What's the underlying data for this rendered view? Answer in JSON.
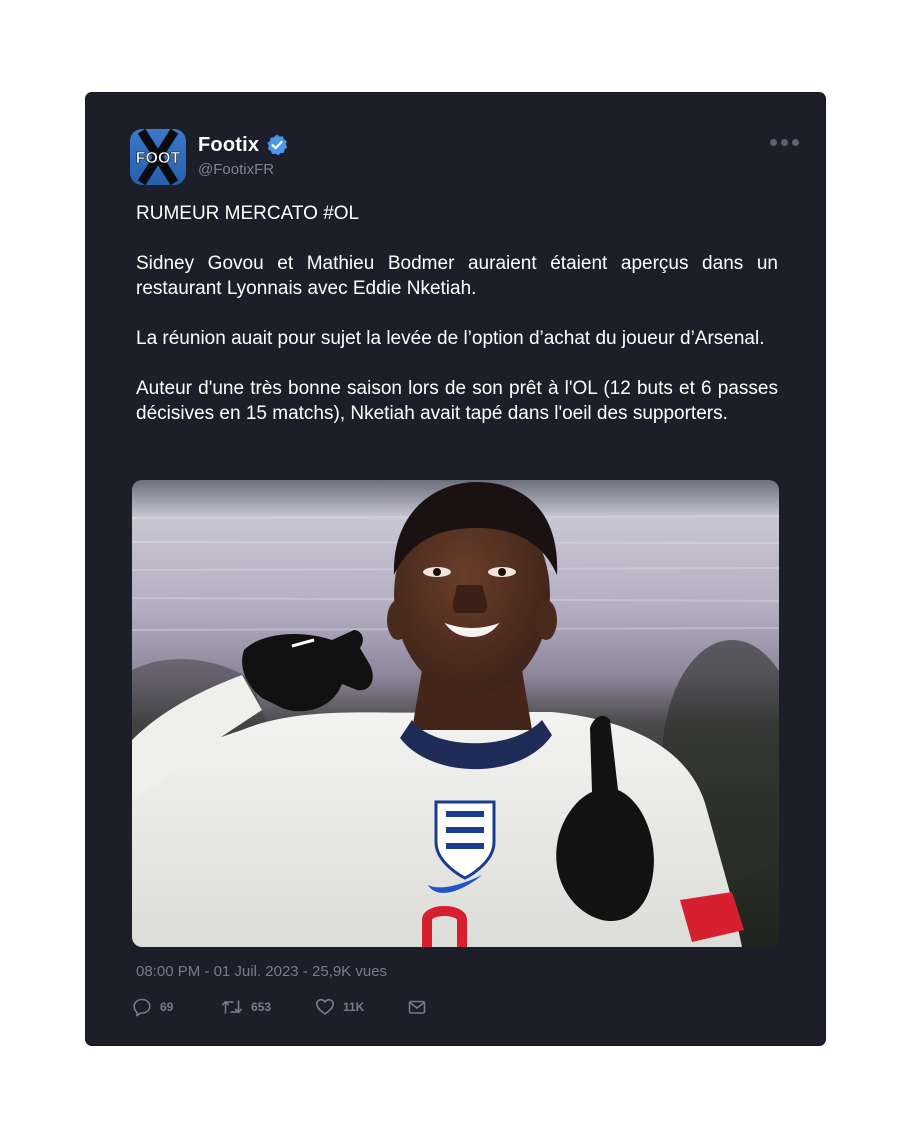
{
  "tweet": {
    "author": {
      "display_name": "Footix",
      "handle": "@FootixFR",
      "avatar_text": "FOOT",
      "verified": true,
      "verified_icon": "verified-badge-icon"
    },
    "more_icon": "more-options-icon",
    "paragraphs": [
      "RUMEUR MERCATO #OL",
      "Sidney Govou et Mathieu Bodmer auraient étaient aperçus dans un restaurant Lyonnais avec Eddie Nketiah.",
      "La réunion auait pour sujet la levée de l’option d’achat du joueur d’Arsenal.",
      "Auteur d'une très bonne saison lors de son prêt à l'OL (12 buts et 6 passes décisives en 15 matchs), Nketiah avait tapé dans l'oeil des supporters."
    ],
    "meta": {
      "time": "08:00 PM",
      "separator": " - ",
      "date": "01 Juil. 2023",
      "views": "25,9K vues"
    },
    "actions": {
      "replies": {
        "icon": "reply-icon",
        "count": "69"
      },
      "retweets": {
        "icon": "retweet-icon",
        "count": "653"
      },
      "likes": {
        "icon": "heart-icon",
        "count": "11K"
      },
      "share": {
        "icon": "mail-icon"
      }
    }
  },
  "colors": {
    "card_background": "#1c1e29",
    "text_primary": "#ffffff",
    "text_secondary": "#767d8a",
    "verified_blue": "#4a99e9",
    "avatar_blue": "#2f6bb8"
  }
}
